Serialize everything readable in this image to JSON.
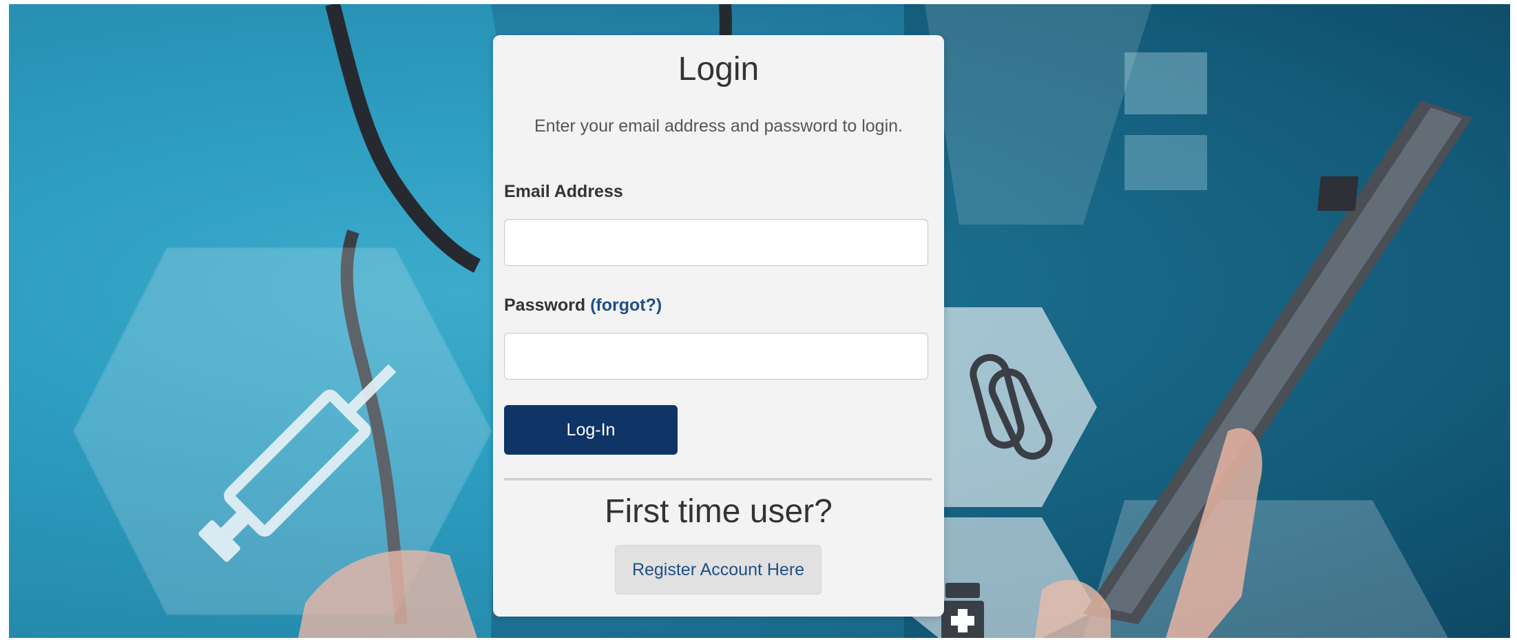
{
  "login": {
    "title": "Login",
    "subtitle": "Enter your email address and password to login.",
    "email_label": "Email Address",
    "email_value": "",
    "password_label": "Password",
    "forgot_link": "(forgot?)",
    "password_value": "",
    "login_button": "Log-In"
  },
  "register": {
    "heading": "First time user?",
    "button": "Register Account Here"
  },
  "background": {
    "icons": [
      "syringe-icon",
      "pills-icon",
      "medicine-bottle-icon"
    ]
  },
  "colors": {
    "panel_bg": "#f3f3f3",
    "primary_button": "#0f3466",
    "link": "#1f4f86",
    "background_teal": "#2b93b8"
  }
}
